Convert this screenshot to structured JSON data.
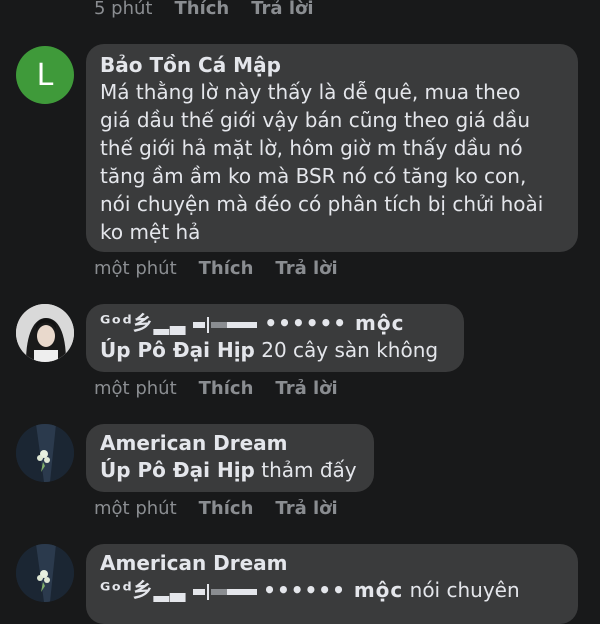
{
  "top_meta": {
    "time": "5 phút",
    "like": "Thích",
    "reply": "Trả lời"
  },
  "comments": [
    {
      "avatar_letter": "L",
      "author": "Bảo Tồn Cá Mập",
      "text_lines": [
        "Má thằng lờ này thấy là dễ quê, mua theo",
        "giá dầu thế giới vậy bán cũng theo giá dầu",
        "thế giới hả mặt lờ, hôm giờ m thấy dầu nó",
        "tăng ầm ầm ko mà BSR nó có tăng ko con,",
        "nói chuyện mà đéo có phân tích bị chửi hoài",
        "ko mệt hả"
      ],
      "meta": {
        "time": "một phút",
        "like": "Thích",
        "reply": "Trả lời"
      }
    },
    {
      "author_prefix": "ᴳᵒᵈ乡▂▃",
      "author_suffix": "•••••• mộc",
      "mention": "Úp Pô Đại Hịp",
      "text": "20 cây sàn không",
      "meta": {
        "time": "một phút",
        "like": "Thích",
        "reply": "Trả lời"
      }
    },
    {
      "author": "American Dream",
      "mention": "Úp Pô Đại Hịp",
      "text": "thảm đấy",
      "meta": {
        "time": "một phút",
        "like": "Thích",
        "reply": "Trả lời"
      }
    },
    {
      "author": "American Dream",
      "mention_prefix": "ᴳᵒᵈ乡▂▃",
      "mention_suffix": "•••••• mộc",
      "text": "nói chuyên"
    }
  ],
  "icons": [
    "letter-avatar",
    "photo-avatar",
    "suit-avatar"
  ],
  "colors": {
    "background": "#18191a",
    "bubble": "#3a3b3c",
    "avatar_green": "#3f9a3a",
    "meta": "#8a8d91",
    "text": "#e4e6eb"
  }
}
